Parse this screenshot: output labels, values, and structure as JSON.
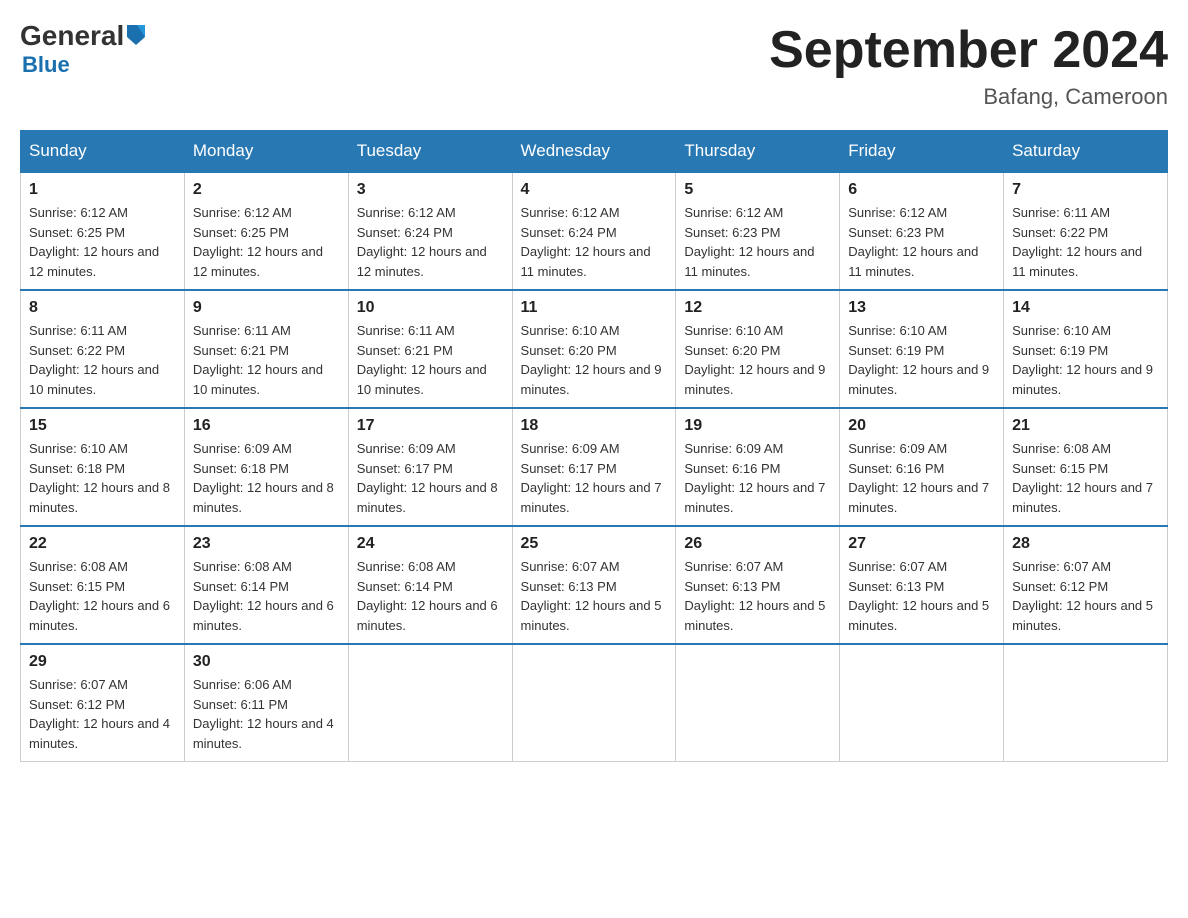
{
  "logo": {
    "general": "General",
    "blue": "Blue",
    "arrow": "▶"
  },
  "title": "September 2024",
  "subtitle": "Bafang, Cameroon",
  "days_of_week": [
    "Sunday",
    "Monday",
    "Tuesday",
    "Wednesday",
    "Thursday",
    "Friday",
    "Saturday"
  ],
  "weeks": [
    [
      {
        "day": "1",
        "sunrise": "6:12 AM",
        "sunset": "6:25 PM",
        "daylight": "12 hours and 12 minutes."
      },
      {
        "day": "2",
        "sunrise": "6:12 AM",
        "sunset": "6:25 PM",
        "daylight": "12 hours and 12 minutes."
      },
      {
        "day": "3",
        "sunrise": "6:12 AM",
        "sunset": "6:24 PM",
        "daylight": "12 hours and 12 minutes."
      },
      {
        "day": "4",
        "sunrise": "6:12 AM",
        "sunset": "6:24 PM",
        "daylight": "12 hours and 11 minutes."
      },
      {
        "day": "5",
        "sunrise": "6:12 AM",
        "sunset": "6:23 PM",
        "daylight": "12 hours and 11 minutes."
      },
      {
        "day": "6",
        "sunrise": "6:12 AM",
        "sunset": "6:23 PM",
        "daylight": "12 hours and 11 minutes."
      },
      {
        "day": "7",
        "sunrise": "6:11 AM",
        "sunset": "6:22 PM",
        "daylight": "12 hours and 11 minutes."
      }
    ],
    [
      {
        "day": "8",
        "sunrise": "6:11 AM",
        "sunset": "6:22 PM",
        "daylight": "12 hours and 10 minutes."
      },
      {
        "day": "9",
        "sunrise": "6:11 AM",
        "sunset": "6:21 PM",
        "daylight": "12 hours and 10 minutes."
      },
      {
        "day": "10",
        "sunrise": "6:11 AM",
        "sunset": "6:21 PM",
        "daylight": "12 hours and 10 minutes."
      },
      {
        "day": "11",
        "sunrise": "6:10 AM",
        "sunset": "6:20 PM",
        "daylight": "12 hours and 9 minutes."
      },
      {
        "day": "12",
        "sunrise": "6:10 AM",
        "sunset": "6:20 PM",
        "daylight": "12 hours and 9 minutes."
      },
      {
        "day": "13",
        "sunrise": "6:10 AM",
        "sunset": "6:19 PM",
        "daylight": "12 hours and 9 minutes."
      },
      {
        "day": "14",
        "sunrise": "6:10 AM",
        "sunset": "6:19 PM",
        "daylight": "12 hours and 9 minutes."
      }
    ],
    [
      {
        "day": "15",
        "sunrise": "6:10 AM",
        "sunset": "6:18 PM",
        "daylight": "12 hours and 8 minutes."
      },
      {
        "day": "16",
        "sunrise": "6:09 AM",
        "sunset": "6:18 PM",
        "daylight": "12 hours and 8 minutes."
      },
      {
        "day": "17",
        "sunrise": "6:09 AM",
        "sunset": "6:17 PM",
        "daylight": "12 hours and 8 minutes."
      },
      {
        "day": "18",
        "sunrise": "6:09 AM",
        "sunset": "6:17 PM",
        "daylight": "12 hours and 7 minutes."
      },
      {
        "day": "19",
        "sunrise": "6:09 AM",
        "sunset": "6:16 PM",
        "daylight": "12 hours and 7 minutes."
      },
      {
        "day": "20",
        "sunrise": "6:09 AM",
        "sunset": "6:16 PM",
        "daylight": "12 hours and 7 minutes."
      },
      {
        "day": "21",
        "sunrise": "6:08 AM",
        "sunset": "6:15 PM",
        "daylight": "12 hours and 7 minutes."
      }
    ],
    [
      {
        "day": "22",
        "sunrise": "6:08 AM",
        "sunset": "6:15 PM",
        "daylight": "12 hours and 6 minutes."
      },
      {
        "day": "23",
        "sunrise": "6:08 AM",
        "sunset": "6:14 PM",
        "daylight": "12 hours and 6 minutes."
      },
      {
        "day": "24",
        "sunrise": "6:08 AM",
        "sunset": "6:14 PM",
        "daylight": "12 hours and 6 minutes."
      },
      {
        "day": "25",
        "sunrise": "6:07 AM",
        "sunset": "6:13 PM",
        "daylight": "12 hours and 5 minutes."
      },
      {
        "day": "26",
        "sunrise": "6:07 AM",
        "sunset": "6:13 PM",
        "daylight": "12 hours and 5 minutes."
      },
      {
        "day": "27",
        "sunrise": "6:07 AM",
        "sunset": "6:13 PM",
        "daylight": "12 hours and 5 minutes."
      },
      {
        "day": "28",
        "sunrise": "6:07 AM",
        "sunset": "6:12 PM",
        "daylight": "12 hours and 5 minutes."
      }
    ],
    [
      {
        "day": "29",
        "sunrise": "6:07 AM",
        "sunset": "6:12 PM",
        "daylight": "12 hours and 4 minutes."
      },
      {
        "day": "30",
        "sunrise": "6:06 AM",
        "sunset": "6:11 PM",
        "daylight": "12 hours and 4 minutes."
      },
      null,
      null,
      null,
      null,
      null
    ]
  ],
  "labels": {
    "sunrise": "Sunrise:",
    "sunset": "Sunset:",
    "daylight": "Daylight:"
  }
}
